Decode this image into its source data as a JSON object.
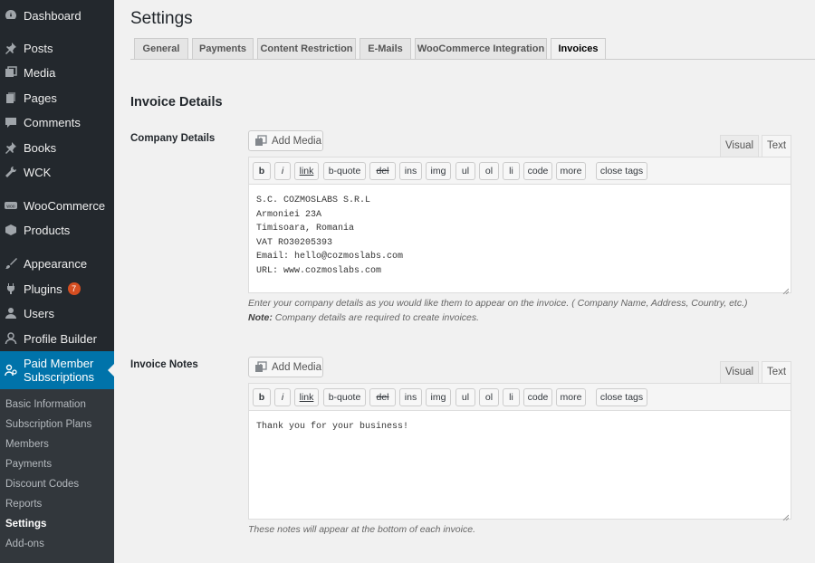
{
  "sidebar": {
    "items": [
      {
        "label": "Dashboard",
        "icon": "dashboard-icon"
      },
      {
        "label": "Posts",
        "icon": "pin-icon"
      },
      {
        "label": "Media",
        "icon": "media-icon"
      },
      {
        "label": "Pages",
        "icon": "pages-icon"
      },
      {
        "label": "Comments",
        "icon": "comment-icon"
      },
      {
        "label": "Books",
        "icon": "pin-icon"
      },
      {
        "label": "WCK",
        "icon": "wrench-icon"
      },
      {
        "label": "WooCommerce",
        "icon": "woocommerce-icon"
      },
      {
        "label": "Products",
        "icon": "box-icon"
      },
      {
        "label": "Appearance",
        "icon": "brush-icon"
      },
      {
        "label": "Plugins",
        "icon": "plugin-icon",
        "badge": "7"
      },
      {
        "label": "Users",
        "icon": "users-icon"
      },
      {
        "label": "Profile Builder",
        "icon": "user-icon"
      },
      {
        "label": "Paid Member Subscriptions",
        "icon": "members-icon"
      }
    ],
    "submenu": [
      "Basic Information",
      "Subscription Plans",
      "Members",
      "Payments",
      "Discount Codes",
      "Reports",
      "Settings",
      "Add-ons"
    ],
    "active_submenu": "Settings"
  },
  "page": {
    "title": "Settings",
    "tabs": [
      "General",
      "Payments",
      "Content Restriction",
      "E-Mails",
      "WooCommerce Integration",
      "Invoices"
    ],
    "active_tab": "Invoices",
    "section_title": "Invoice Details"
  },
  "company": {
    "label": "Company Details",
    "add_media": "Add Media",
    "mode_visual": "Visual",
    "mode_text": "Text",
    "content": "S.C. COZMOSLABS S.R.L\nArmoniei 23A\nTimisoara, Romania\nVAT RO30205393\nEmail: hello@cozmoslabs.com\nURL: www.cozmoslabs.com",
    "help_line1": "Enter your company details as you would like them to appear on the invoice. ( Company Name, Address, Country, etc.)",
    "help_note_label": "Note:",
    "help_note_text": " Company details are required to create invoices."
  },
  "notes": {
    "label": "Invoice Notes",
    "add_media": "Add Media",
    "mode_visual": "Visual",
    "mode_text": "Text",
    "content": "Thank you for your business!",
    "help": "These notes will appear at the bottom of each invoice."
  },
  "quicktags": [
    "b",
    "i",
    "link",
    "b-quote",
    "del",
    "ins",
    "img",
    "ul",
    "ol",
    "li",
    "code",
    "more",
    "close tags"
  ],
  "colors": {
    "sidebar_bg": "#23282d",
    "submenu_bg": "#32373c",
    "accent": "#0073aa",
    "badge": "#d54e21"
  }
}
